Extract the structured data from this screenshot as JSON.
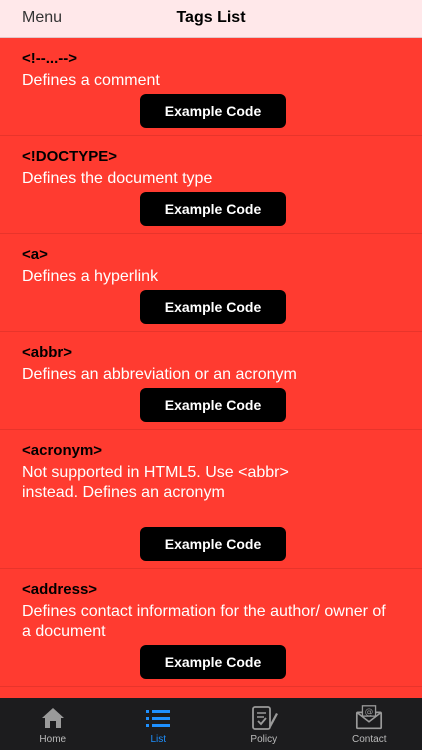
{
  "nav": {
    "left": "Menu",
    "title": "Tags List"
  },
  "items": [
    {
      "tag": "<!--...-->",
      "desc": "Defines a comment",
      "button": "Example Code"
    },
    {
      "tag": "<!DOCTYPE>",
      "desc": "Defines the document type",
      "button": "Example Code"
    },
    {
      "tag": "<a>",
      "desc": "Defines a hyperlink",
      "button": "Example Code"
    },
    {
      "tag": "<abbr>",
      "desc": "Defines an abbreviation or an acronym",
      "button": "Example Code"
    },
    {
      "tag": "<acronym>",
      "desc": "Not supported in HTML5. Use <abbr> instead. Defines an acronym",
      "button": "Example Code"
    },
    {
      "tag": "<address>",
      "desc": "Defines contact information for the author/ owner of a document",
      "button": "Example Code"
    }
  ],
  "tabs": [
    {
      "label": "Home",
      "icon": "home-icon"
    },
    {
      "label": "List",
      "icon": "list-icon"
    },
    {
      "label": "Policy",
      "icon": "policy-icon"
    },
    {
      "label": "Contact",
      "icon": "contact-icon"
    }
  ]
}
